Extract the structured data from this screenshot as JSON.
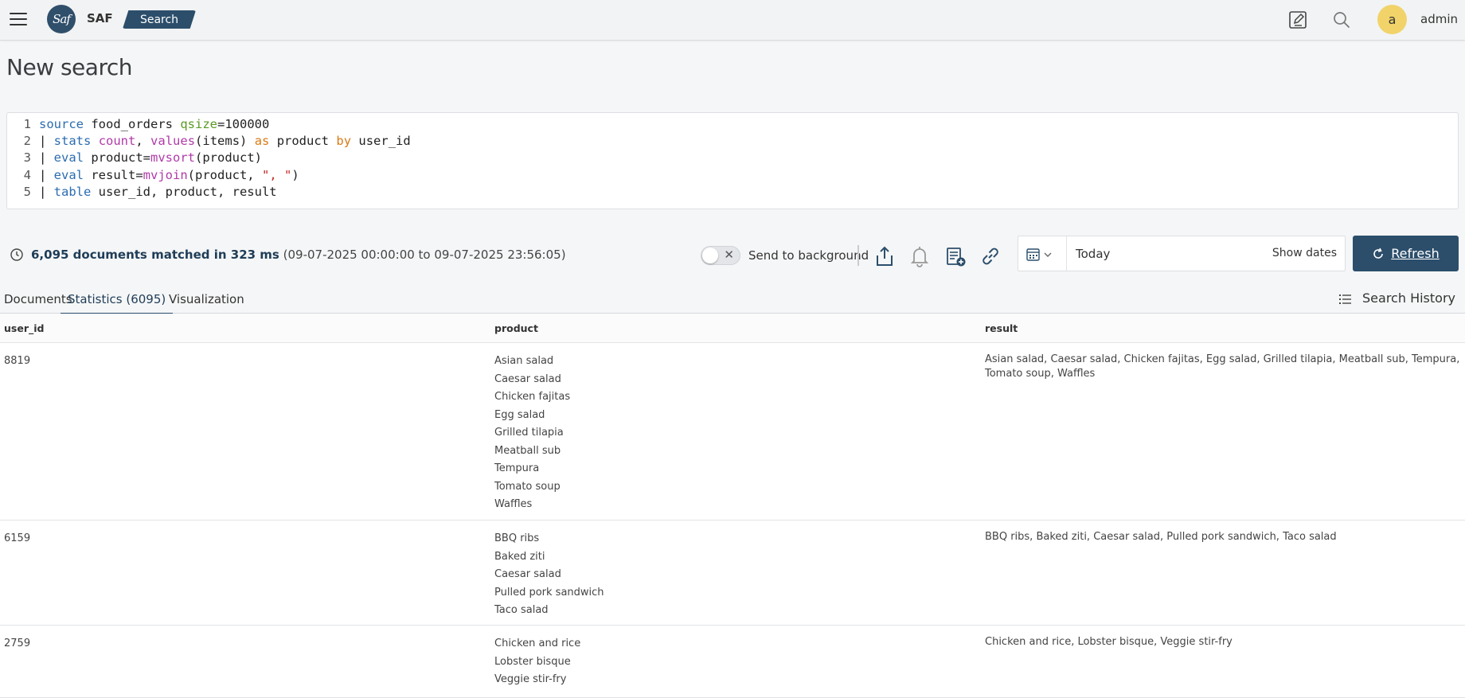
{
  "header": {
    "logo_text": "Saf",
    "brand": "SAF",
    "search_label": "Search",
    "avatar_initial": "a",
    "username": "admin",
    "icons": [
      "menu-icon",
      "edit-icon",
      "search-icon"
    ]
  },
  "page": {
    "title": "New search"
  },
  "query": {
    "lines": [
      {
        "num": "1",
        "parts": [
          [
            "kw",
            "source"
          ],
          [
            "txt",
            " food_orders "
          ],
          [
            "arg",
            "qsize"
          ],
          [
            "txt",
            "=100000"
          ]
        ]
      },
      {
        "num": "2",
        "parts": [
          [
            "txt",
            "| "
          ],
          [
            "kw",
            "stats"
          ],
          [
            "txt",
            " "
          ],
          [
            "fn",
            "count"
          ],
          [
            "txt",
            ", "
          ],
          [
            "fn",
            "values"
          ],
          [
            "txt",
            "(items) "
          ],
          [
            "op",
            "as"
          ],
          [
            "txt",
            " product "
          ],
          [
            "op",
            "by"
          ],
          [
            "txt",
            " user_id"
          ]
        ]
      },
      {
        "num": "3",
        "parts": [
          [
            "txt",
            "| "
          ],
          [
            "kw",
            "eval"
          ],
          [
            "txt",
            " product="
          ],
          [
            "fn",
            "mvsort"
          ],
          [
            "txt",
            "(product)"
          ]
        ]
      },
      {
        "num": "4",
        "parts": [
          [
            "txt",
            "| "
          ],
          [
            "kw",
            "eval"
          ],
          [
            "txt",
            " result="
          ],
          [
            "fn",
            "mvjoin"
          ],
          [
            "txt",
            "(product, "
          ],
          [
            "str",
            "\", \""
          ],
          [
            "txt",
            ")"
          ]
        ]
      },
      {
        "num": "5",
        "parts": [
          [
            "txt",
            "| "
          ],
          [
            "kw",
            "table"
          ],
          [
            "txt",
            " user_id, product, result"
          ]
        ]
      }
    ]
  },
  "status": {
    "matched_text": "6,095 documents matched in 323 ms",
    "range_text": "(09-07-2025 00:00:00 to 09-07-2025 23:56:05)",
    "send_to_background": "Send to background",
    "toggle_on": false
  },
  "date": {
    "value": "Today",
    "show_dates": "Show dates"
  },
  "refresh_label": "Refresh",
  "tabs": [
    {
      "label": "Documents",
      "active": false
    },
    {
      "label": "Statistics (6095)",
      "active": true
    },
    {
      "label": "Visualization",
      "active": false
    }
  ],
  "search_history_label": "Search History",
  "table": {
    "columns": [
      "user_id",
      "product",
      "result"
    ],
    "rows": [
      {
        "user_id": "8819",
        "product": [
          "Asian salad",
          "Caesar salad",
          "Chicken fajitas",
          "Egg salad",
          "Grilled tilapia",
          "Meatball sub",
          "Tempura",
          "Tomato soup",
          "Waffles"
        ],
        "result": "Asian salad, Caesar salad, Chicken fajitas, Egg salad, Grilled tilapia, Meatball sub, Tempura, Tomato soup, Waffles"
      },
      {
        "user_id": "6159",
        "product": [
          "BBQ ribs",
          "Baked ziti",
          "Caesar salad",
          "Pulled pork sandwich",
          "Taco salad"
        ],
        "result": "BBQ ribs, Baked ziti, Caesar salad, Pulled pork sandwich, Taco salad"
      },
      {
        "user_id": "2759",
        "product": [
          "Chicken and rice",
          "Lobster bisque",
          "Veggie stir-fry"
        ],
        "result": "Chicken and rice, Lobster bisque, Veggie stir-fry"
      }
    ]
  },
  "colors": {
    "brand_dark": "#2c4e6b",
    "avatar": "#f1d36a",
    "keyword": "#2b6cb0",
    "function": "#b03aa8",
    "operator": "#d97a16",
    "argument": "#5a9a20",
    "string": "#c22a2a"
  }
}
